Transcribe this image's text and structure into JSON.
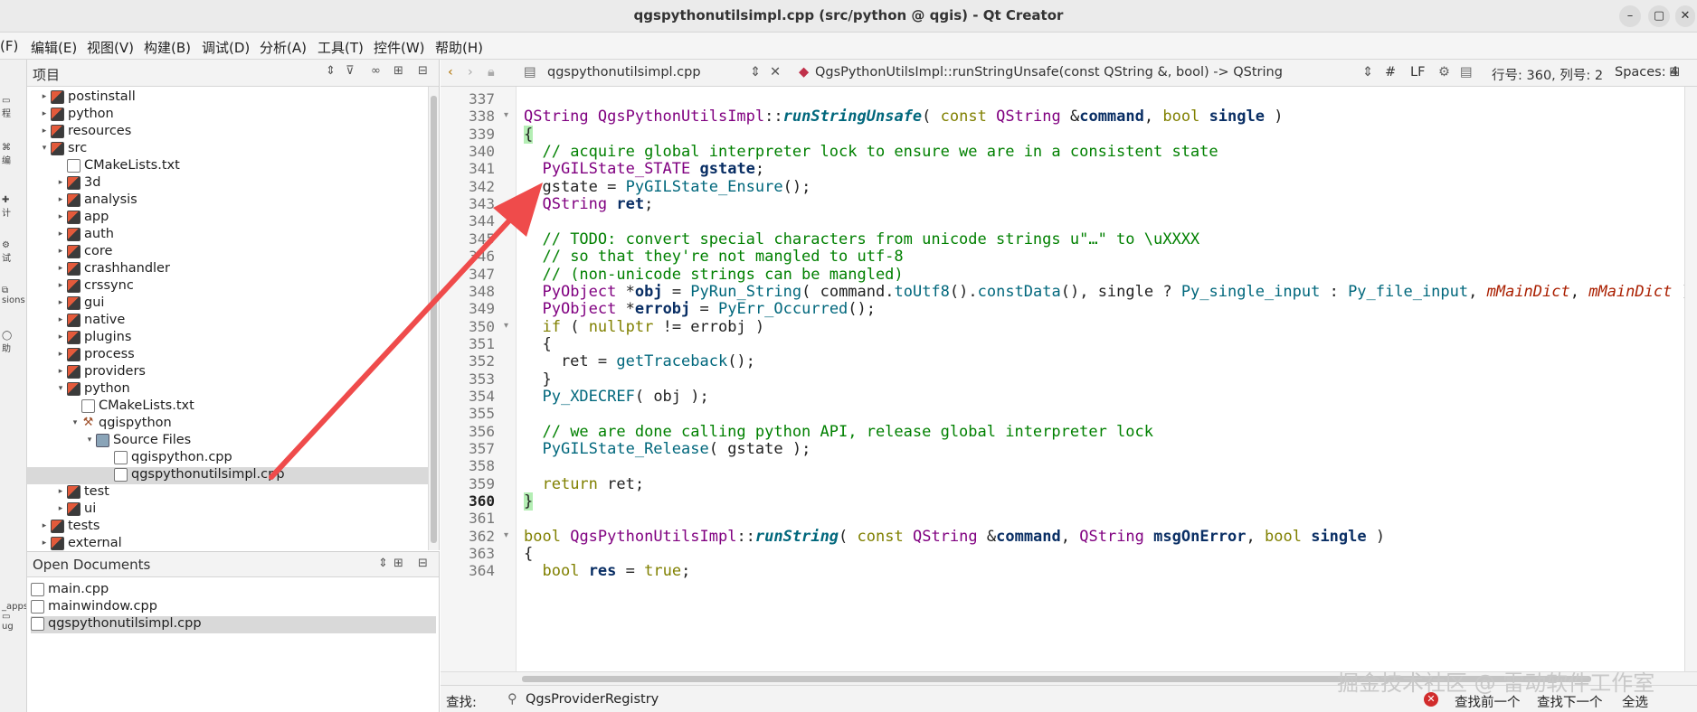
{
  "window": {
    "title": "qgspythonutilsimpl.cpp (src/python @ qgis) - Qt Creator",
    "minimize": "–",
    "maximize": "▢",
    "close": "✕"
  },
  "menu": [
    "(F)",
    "编辑(E)",
    "视图(V)",
    "构建(B)",
    "调试(D)",
    "分析(A)",
    "工具(T)",
    "控件(W)",
    "帮助(H)"
  ],
  "modebar": [
    "",
    "程",
    "C",
    "编",
    "计",
    "试",
    "目",
    "sions",
    "助",
    "_apps",
    "ug"
  ],
  "project_panel": {
    "title": "项目",
    "tree": [
      {
        "label": "postinstall",
        "depth": 1,
        "arrow": "▸",
        "icon": "folder"
      },
      {
        "label": "python",
        "depth": 1,
        "arrow": "▸",
        "icon": "folder"
      },
      {
        "label": "resources",
        "depth": 1,
        "arrow": "▸",
        "icon": "folder"
      },
      {
        "label": "src",
        "depth": 1,
        "arrow": "▾",
        "icon": "folder"
      },
      {
        "label": "CMakeLists.txt",
        "depth": 2,
        "arrow": "",
        "icon": "file"
      },
      {
        "label": "3d",
        "depth": 2,
        "arrow": "▸",
        "icon": "folder"
      },
      {
        "label": "analysis",
        "depth": 2,
        "arrow": "▸",
        "icon": "folder"
      },
      {
        "label": "app",
        "depth": 2,
        "arrow": "▸",
        "icon": "folder"
      },
      {
        "label": "auth",
        "depth": 2,
        "arrow": "▸",
        "icon": "folder"
      },
      {
        "label": "core",
        "depth": 2,
        "arrow": "▸",
        "icon": "folder"
      },
      {
        "label": "crashhandler",
        "depth": 2,
        "arrow": "▸",
        "icon": "folder"
      },
      {
        "label": "crssync",
        "depth": 2,
        "arrow": "▸",
        "icon": "folder"
      },
      {
        "label": "gui",
        "depth": 2,
        "arrow": "▸",
        "icon": "folder"
      },
      {
        "label": "native",
        "depth": 2,
        "arrow": "▸",
        "icon": "folder"
      },
      {
        "label": "plugins",
        "depth": 2,
        "arrow": "▸",
        "icon": "folder"
      },
      {
        "label": "process",
        "depth": 2,
        "arrow": "▸",
        "icon": "folder"
      },
      {
        "label": "providers",
        "depth": 2,
        "arrow": "▸",
        "icon": "folder"
      },
      {
        "label": "python",
        "depth": 2,
        "arrow": "▾",
        "icon": "folder"
      },
      {
        "label": "CMakeLists.txt",
        "depth": 3,
        "arrow": "",
        "icon": "file"
      },
      {
        "label": "qgispython",
        "depth": 3,
        "arrow": "▾",
        "icon": "tool"
      },
      {
        "label": "Source Files",
        "depth": 4,
        "arrow": "▾",
        "icon": "src"
      },
      {
        "label": "qgispython.cpp",
        "depth": 5,
        "arrow": "",
        "icon": "file"
      },
      {
        "label": "qgspythonutilsimpl.cpp",
        "depth": 5,
        "arrow": "",
        "icon": "file",
        "selected": true
      },
      {
        "label": "test",
        "depth": 2,
        "arrow": "▸",
        "icon": "folder"
      },
      {
        "label": "ui",
        "depth": 2,
        "arrow": "▸",
        "icon": "folder"
      },
      {
        "label": "tests",
        "depth": 1,
        "arrow": "▸",
        "icon": "folder"
      },
      {
        "label": "external",
        "depth": 1,
        "arrow": "▸",
        "icon": "folder"
      }
    ]
  },
  "open_documents": {
    "title": "Open Documents",
    "items": [
      {
        "label": "main.cpp"
      },
      {
        "label": "mainwindow.cpp"
      },
      {
        "label": "qgspythonutilsimpl.cpp",
        "selected": true
      }
    ]
  },
  "editor_toolbar": {
    "file": "qgspythonutilsimpl.cpp",
    "symbol": "QgsPythonUtilsImpl::runStringUnsafe(const QString &, bool) -> QString",
    "hash": "#",
    "line_ending": "LF",
    "position": "行号: 360, 列号: 2",
    "spaces": "Spaces: 4"
  },
  "code": {
    "current_line": 360,
    "lines": [
      {
        "n": "337",
        "html": ""
      },
      {
        "n": "338",
        "fold": "▾",
        "html": "<span class='t'>QString</span> <span class='t'>QgsPythonUtilsImpl</span>::<span class='f' style='font-style:italic;font-weight:bold'>runStringUnsafe</span>( <span class='k'>const</span> <span class='t'>QString</span> &amp;<span class='b'>command</span>, <span class='k'>bool</span> <span class='b'>single</span> )"
      },
      {
        "n": "339",
        "html": "<span class='brace-hl'>{</span>"
      },
      {
        "n": "340",
        "html": "  <span class='c'>// acquire global interpreter lock to ensure we are in a consistent state</span>"
      },
      {
        "n": "341",
        "html": "  <span class='t'>PyGILState_STATE</span> <span class='b'>gstate</span>;"
      },
      {
        "n": "342",
        "html": "  gstate = <span class='f'>PyGILState_Ensure</span>();"
      },
      {
        "n": "343",
        "html": "  <span class='t'>QString</span> <span class='b'>ret</span>;"
      },
      {
        "n": "344",
        "html": ""
      },
      {
        "n": "345",
        "html": "  <span class='c'>// TODO: convert special characters from unicode strings u\"…\" to \\uXXXX</span>"
      },
      {
        "n": "346",
        "html": "  <span class='c'>// so that they're not mangled to utf-8</span>"
      },
      {
        "n": "347",
        "html": "  <span class='c'>// (non-unicode strings can be mangled)</span>"
      },
      {
        "n": "348",
        "html": "  <span class='t'>PyObject</span> *<span class='b'>obj</span> = <span class='f'>PyRun_String</span>( command.<span class='f'>toUtf8</span>().<span class='f'>constData</span>(), single ? <span class='f'>Py_single_input</span> : <span class='f'>Py_file_input</span>, <span class='i'>mMainDict</span>, <span class='i'>mMainDict</span> );"
      },
      {
        "n": "349",
        "html": "  <span class='t'>PyObject</span> *<span class='b'>errobj</span> = <span class='f'>PyErr_Occurred</span>();"
      },
      {
        "n": "350",
        "fold": "▾",
        "html": "  <span class='k'>if</span> ( <span class='k'>nullptr</span> != errobj )"
      },
      {
        "n": "351",
        "html": "  {"
      },
      {
        "n": "352",
        "html": "    ret = <span class='f'>getTraceback</span>();"
      },
      {
        "n": "353",
        "html": "  }"
      },
      {
        "n": "354",
        "html": "  <span class='f'>Py_XDECREF</span>( obj );"
      },
      {
        "n": "355",
        "html": ""
      },
      {
        "n": "356",
        "html": "  <span class='c'>// we are done calling python API, release global interpreter lock</span>"
      },
      {
        "n": "357",
        "html": "  <span class='f'>PyGILState_Release</span>( gstate );"
      },
      {
        "n": "358",
        "html": ""
      },
      {
        "n": "359",
        "html": "  <span class='k'>return</span> ret;"
      },
      {
        "n": "360",
        "html": "<span class='brace-hl'>}</span>"
      },
      {
        "n": "361",
        "html": ""
      },
      {
        "n": "362",
        "fold": "▾",
        "html": "<span class='k'>bool</span> <span class='t'>QgsPythonUtilsImpl</span>::<span class='f' style='font-style:italic;font-weight:bold'>runString</span>( <span class='k'>const</span> <span class='t'>QString</span> &amp;<span class='b'>command</span>, <span class='t'>QString</span> <span class='b'>msgOnError</span>, <span class='k'>bool</span> <span class='b'>single</span> )"
      },
      {
        "n": "363",
        "html": "{"
      },
      {
        "n": "364",
        "html": "  <span class='k'>bool</span> <span class='b'>res</span> = <span class='k'>true</span>;"
      }
    ]
  },
  "find_bar": {
    "label": "查找:",
    "value": "QgsProviderRegistry",
    "find_prev": "查找前一个",
    "find_next": "查找下一个",
    "select_all": "全选"
  },
  "watermark": "掘金技术社区 @ 雷动软件工作室",
  "colors": {
    "annotation_arrow": "#ef4b4b",
    "selection": "#d9d9d9"
  }
}
